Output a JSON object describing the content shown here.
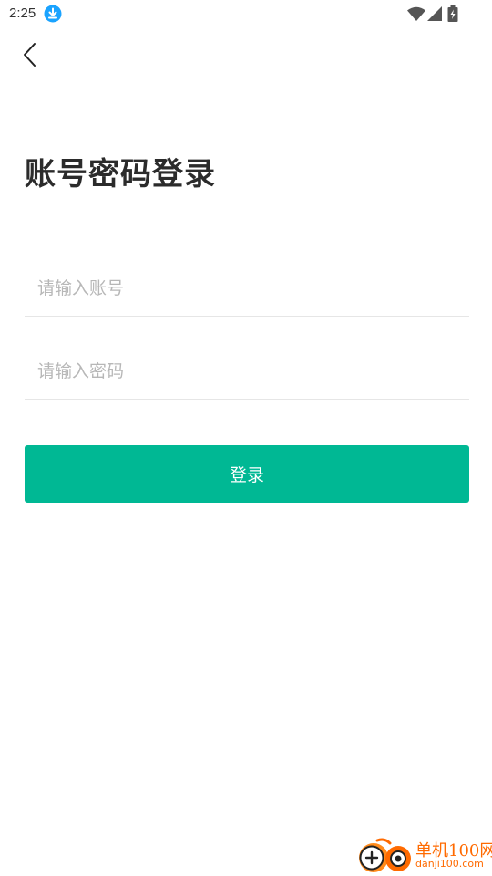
{
  "status_bar": {
    "time": "2:25",
    "icons": [
      "download-icon",
      "wifi-icon",
      "signal-icon",
      "battery-icon"
    ]
  },
  "nav": {
    "back_icon": "chevron-left-icon"
  },
  "title": "账号密码登录",
  "form": {
    "account_placeholder": "请输入账号",
    "account_value": "",
    "password_placeholder": "请输入密码",
    "password_value": "",
    "submit_label": "登录"
  },
  "colors": {
    "primary": "#00b894",
    "download_badge": "#1aa3ff",
    "watermark": "#ff6a00"
  },
  "watermark": {
    "name": "单机100网",
    "url": "danji100.com"
  }
}
